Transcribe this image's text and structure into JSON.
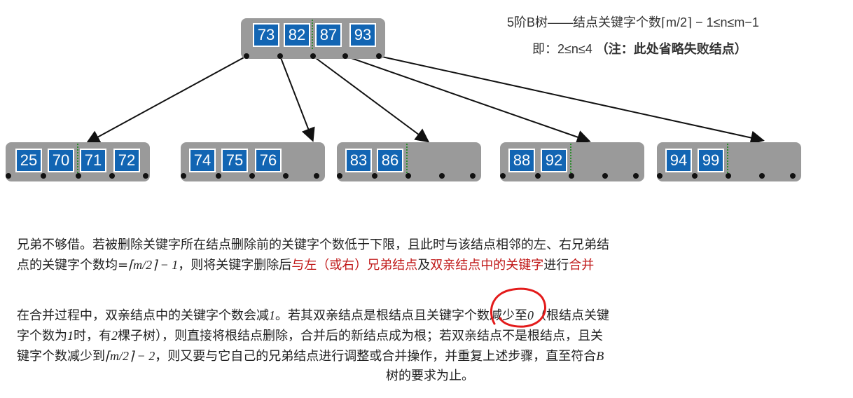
{
  "title": {
    "line1": "5阶B树——结点关键字个数⌈m/2⌉ − 1≤n≤m−1",
    "line2_prefix": "即：2≤n≤4 ",
    "line2_bold": "（注：此处省略失败结点）"
  },
  "tree": {
    "root": [
      "73",
      "82",
      "87",
      "93"
    ],
    "children": [
      [
        "25",
        "70",
        "71",
        "72"
      ],
      [
        "74",
        "75",
        "76"
      ],
      [
        "83",
        "86"
      ],
      [
        "88",
        "92"
      ],
      [
        "94",
        "99"
      ]
    ]
  },
  "para1": {
    "t1": "兄弟不够借。若被删除关键字所在结点删除前的关键字个数低于下限，且此时与该结点相邻的左、右兄弟结",
    "t2a": "点的关键字个数均=",
    "t2math": "⌈m/2⌉ − 1",
    "t2b": "，则将关键字删除后",
    "t2red1": "与左（或右）兄弟结点",
    "t2c": "及",
    "t2red2": "双亲结点中的关键字",
    "t2d": "进行",
    "t2red3": "合并"
  },
  "para2": {
    "t1a": "在合并过程中，双亲结点中的关键字个数会减",
    "t1m1": "1",
    "t1b": "。若其双亲结点是",
    "t1c": "根结点",
    "t1d": "且关键字个数减少至",
    "t1m2": "0",
    "t1e": "（根结点关键",
    "t2a": "字个数为",
    "t2m": "1",
    "t2b": "时，有",
    "t2n": "2",
    "t2c": "棵子树），则直接将根结点删除，合并后的新结点成为根；若双亲结点不是根结点，且关",
    "t3a": "键字个数减少到",
    "t3m": "⌈m/2⌉ − 2",
    "t3b": "，则又要与它自己的兄弟结点进行调整或合并操作，并重复上述步骤，直至符合",
    "t3m2": "B",
    "t4": "树的要求为止。"
  }
}
